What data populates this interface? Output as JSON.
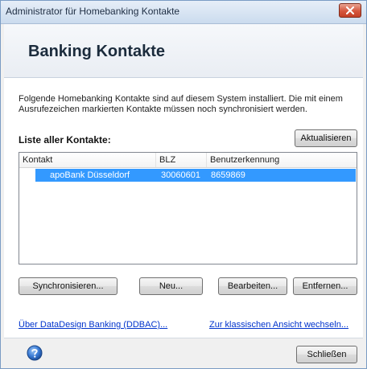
{
  "window": {
    "title": "Administrator für Homebanking Kontakte"
  },
  "header": {
    "title": "Banking Kontakte"
  },
  "main": {
    "description": "Folgende Homebanking Kontakte sind auf diesem System installiert. Die mit einem Ausrufezeichen markierten Kontakte müssen noch synchronisiert werden.",
    "list_label": "Liste aller Kontakte:",
    "refresh_label": "Aktualisieren",
    "columns": [
      "Kontakt",
      "BLZ",
      "Benutzerkennung"
    ],
    "rows": [
      {
        "kontakt": "apoBank Düsseldorf",
        "blz": "30060601",
        "benutzerkennung": "8659869",
        "icon": "bank-contact-icon",
        "selected": true
      }
    ],
    "buttons": {
      "sync": "Synchronisieren...",
      "new": "Neu...",
      "edit": "Bearbeiten...",
      "remove": "Entfernen..."
    },
    "links": {
      "about": "Über DataDesign Banking (DDBAC)...",
      "classic_view": "Zur klassischen Ansicht wechseln..."
    }
  },
  "footer": {
    "close_label": "Schließen",
    "help_icon": "help-icon"
  },
  "colors": {
    "selection": "#3399ff",
    "link": "#0033cc",
    "close_button": "#c9452c"
  }
}
